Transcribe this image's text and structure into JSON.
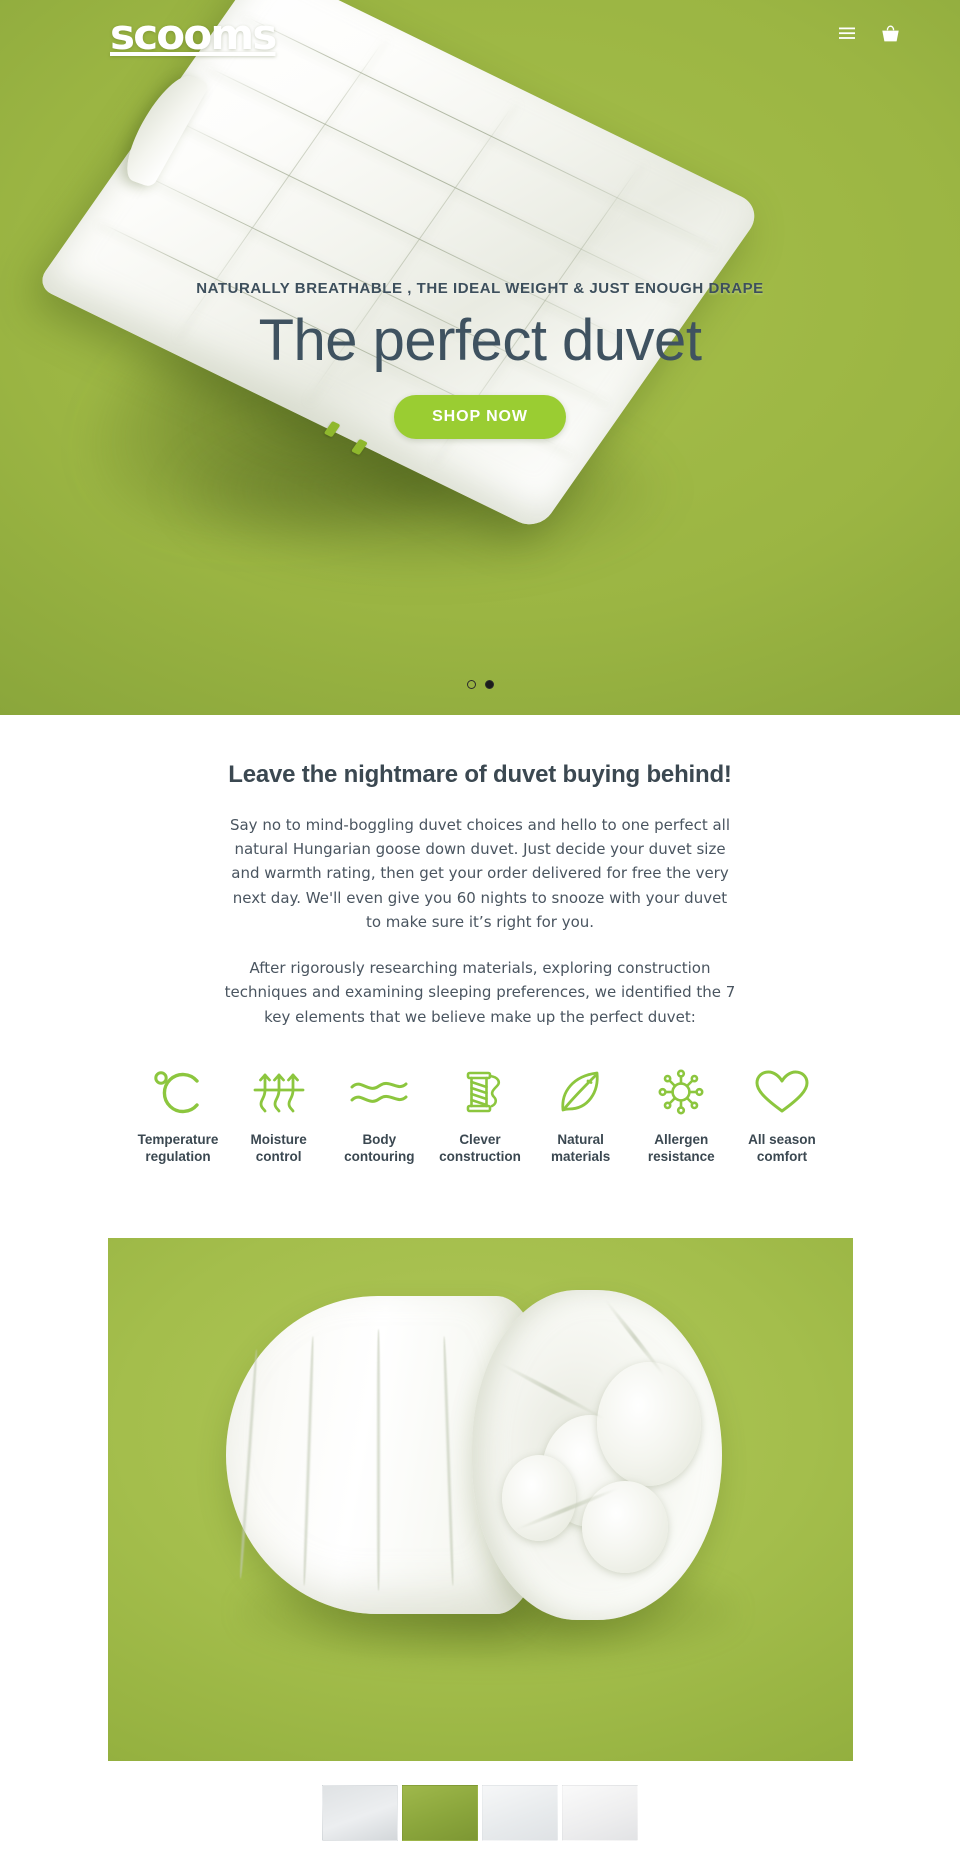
{
  "site": {
    "brand": "scooms",
    "accent_green": "#9acd32",
    "hero_bg_green": "#9bb543",
    "text_dark": "#3b4851",
    "hero_text_color": "#3f5260"
  },
  "header": {
    "menu_icon": "hamburger-menu-icon",
    "menu_label": "Menu",
    "cart_icon": "shopping-basket-icon",
    "cart_label": "Basket"
  },
  "hero": {
    "eyebrow": "NATURALLY BREATHABLE , THE IDEAL WEIGHT & JUST ENOUGH DRAPE",
    "title": "The perfect duvet",
    "cta_label": "SHOP NOW",
    "image_alt": "White Hungarian goose down duvet floating on a green background",
    "carousel": {
      "slide_count": 2,
      "active_index": 1,
      "dots": [
        {
          "label": "Slide 1",
          "active": false
        },
        {
          "label": "Slide 2",
          "active": true
        }
      ]
    }
  },
  "intro": {
    "heading": "Leave the nightmare of duvet buying behind!",
    "paragraph_1": "Say no to mind-boggling duvet choices and hello to one perfect all natural Hungarian goose down duvet. Just decide your duvet size and warmth rating, then get your order delivered for free the very next day. We'll even give you 60 nights to snooze with your duvet to make sure it’s right for you.",
    "paragraph_2": "After rigorously researching materials, exploring construction techniques and examining sleeping preferences, we identified the 7 key elements that we believe make up the perfect duvet:"
  },
  "features": [
    {
      "icon": "celsius-thermometer-icon",
      "label": "Temperature\nregulation"
    },
    {
      "icon": "moisture-arrows-icon",
      "label": "Moisture\ncontrol"
    },
    {
      "icon": "wavy-lines-icon",
      "label": "Body\ncontouring"
    },
    {
      "icon": "thread-spool-icon",
      "label": "Clever\nconstruction"
    },
    {
      "icon": "leaf-icon",
      "label": "Natural\nmaterials"
    },
    {
      "icon": "allergen-molecule-icon",
      "label": "Allergen\nresistance"
    },
    {
      "icon": "heart-icon",
      "label": "All season\ncomfort"
    }
  ],
  "product": {
    "image_alt": "Rolled up white goose down duvet on a green background"
  },
  "thumbnails": [
    {
      "label": "Thumbnail 1",
      "selected": false
    },
    {
      "label": "Thumbnail 2",
      "selected": true
    },
    {
      "label": "Thumbnail 3",
      "selected": false
    },
    {
      "label": "Thumbnail 4",
      "selected": false
    }
  ]
}
